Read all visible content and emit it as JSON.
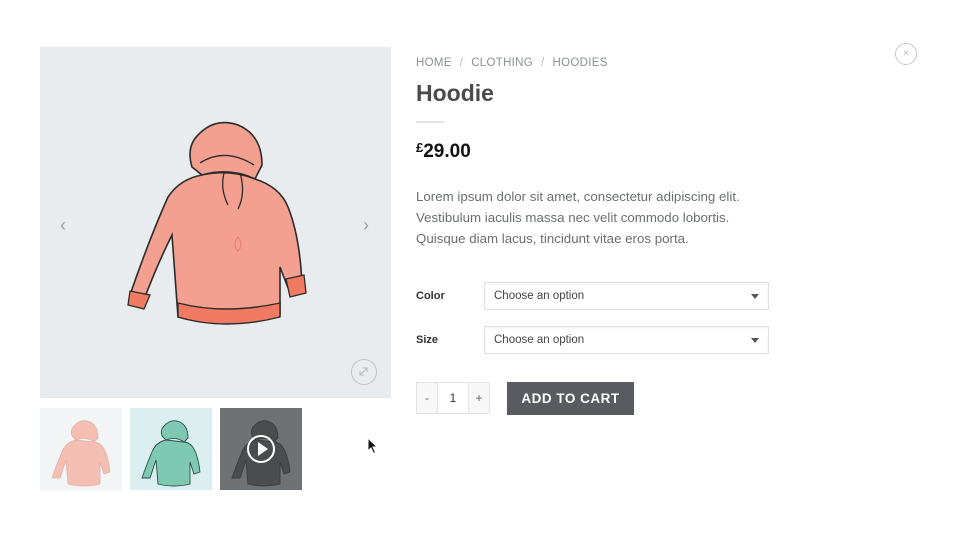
{
  "gallery": {
    "prev_arrow": "‹",
    "next_arrow": "›",
    "main_image_icon": "hoodie-image",
    "thumbnails": [
      {
        "icon": "hoodie-pink-thumbnail"
      },
      {
        "icon": "hoodie-teal-thumbnail"
      },
      {
        "icon": "video-play-thumbnail"
      }
    ]
  },
  "close_icon": "×",
  "breadcrumb": {
    "items": [
      "HOME",
      "CLOTHING",
      "HOODIES"
    ],
    "separator": "/"
  },
  "product": {
    "title": "Hoodie",
    "currency": "£",
    "price": "29.00",
    "description_lines": [
      "Lorem ipsum dolor sit amet, consectetur adipiscing elit.",
      "Vestibulum iaculis massa nec velit commodo lobortis.",
      "Quisque diam lacus, tincidunt vitae eros porta."
    ]
  },
  "variations": {
    "color": {
      "label": "Color",
      "value": "Choose an option"
    },
    "size": {
      "label": "Size",
      "value": "Choose an option"
    }
  },
  "cart": {
    "minus": "-",
    "quantity": "1",
    "plus": "+",
    "add_label": "ADD TO CART"
  },
  "colors": {
    "hoodie": "#f4a090",
    "hoodie_trim": "#f07a62",
    "button": "#5a5b60",
    "gallery_bg": "#e9ecef"
  }
}
